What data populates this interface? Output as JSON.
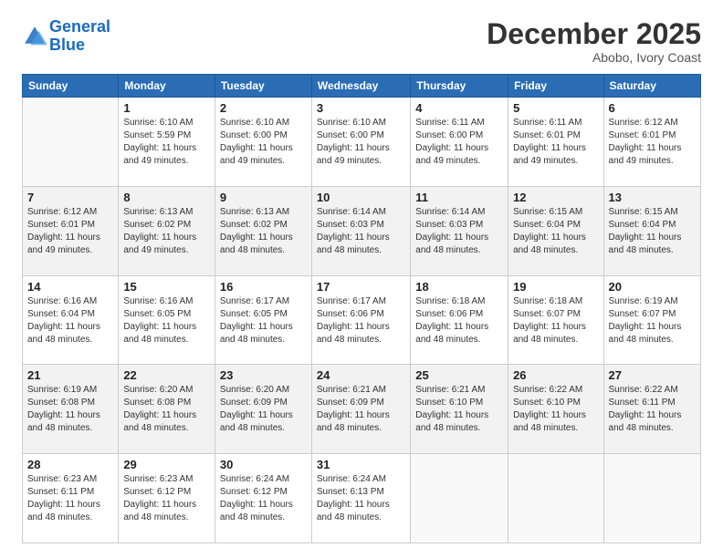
{
  "logo": {
    "line1": "General",
    "line2": "Blue"
  },
  "title": "December 2025",
  "subtitle": "Abobo, Ivory Coast",
  "weekdays": [
    "Sunday",
    "Monday",
    "Tuesday",
    "Wednesday",
    "Thursday",
    "Friday",
    "Saturday"
  ],
  "weeks": [
    [
      {
        "day": "",
        "info": ""
      },
      {
        "day": "1",
        "info": "Sunrise: 6:10 AM\nSunset: 5:59 PM\nDaylight: 11 hours\nand 49 minutes."
      },
      {
        "day": "2",
        "info": "Sunrise: 6:10 AM\nSunset: 6:00 PM\nDaylight: 11 hours\nand 49 minutes."
      },
      {
        "day": "3",
        "info": "Sunrise: 6:10 AM\nSunset: 6:00 PM\nDaylight: 11 hours\nand 49 minutes."
      },
      {
        "day": "4",
        "info": "Sunrise: 6:11 AM\nSunset: 6:00 PM\nDaylight: 11 hours\nand 49 minutes."
      },
      {
        "day": "5",
        "info": "Sunrise: 6:11 AM\nSunset: 6:01 PM\nDaylight: 11 hours\nand 49 minutes."
      },
      {
        "day": "6",
        "info": "Sunrise: 6:12 AM\nSunset: 6:01 PM\nDaylight: 11 hours\nand 49 minutes."
      }
    ],
    [
      {
        "day": "7",
        "info": "Sunrise: 6:12 AM\nSunset: 6:01 PM\nDaylight: 11 hours\nand 49 minutes."
      },
      {
        "day": "8",
        "info": "Sunrise: 6:13 AM\nSunset: 6:02 PM\nDaylight: 11 hours\nand 49 minutes."
      },
      {
        "day": "9",
        "info": "Sunrise: 6:13 AM\nSunset: 6:02 PM\nDaylight: 11 hours\nand 48 minutes."
      },
      {
        "day": "10",
        "info": "Sunrise: 6:14 AM\nSunset: 6:03 PM\nDaylight: 11 hours\nand 48 minutes."
      },
      {
        "day": "11",
        "info": "Sunrise: 6:14 AM\nSunset: 6:03 PM\nDaylight: 11 hours\nand 48 minutes."
      },
      {
        "day": "12",
        "info": "Sunrise: 6:15 AM\nSunset: 6:04 PM\nDaylight: 11 hours\nand 48 minutes."
      },
      {
        "day": "13",
        "info": "Sunrise: 6:15 AM\nSunset: 6:04 PM\nDaylight: 11 hours\nand 48 minutes."
      }
    ],
    [
      {
        "day": "14",
        "info": "Sunrise: 6:16 AM\nSunset: 6:04 PM\nDaylight: 11 hours\nand 48 minutes."
      },
      {
        "day": "15",
        "info": "Sunrise: 6:16 AM\nSunset: 6:05 PM\nDaylight: 11 hours\nand 48 minutes."
      },
      {
        "day": "16",
        "info": "Sunrise: 6:17 AM\nSunset: 6:05 PM\nDaylight: 11 hours\nand 48 minutes."
      },
      {
        "day": "17",
        "info": "Sunrise: 6:17 AM\nSunset: 6:06 PM\nDaylight: 11 hours\nand 48 minutes."
      },
      {
        "day": "18",
        "info": "Sunrise: 6:18 AM\nSunset: 6:06 PM\nDaylight: 11 hours\nand 48 minutes."
      },
      {
        "day": "19",
        "info": "Sunrise: 6:18 AM\nSunset: 6:07 PM\nDaylight: 11 hours\nand 48 minutes."
      },
      {
        "day": "20",
        "info": "Sunrise: 6:19 AM\nSunset: 6:07 PM\nDaylight: 11 hours\nand 48 minutes."
      }
    ],
    [
      {
        "day": "21",
        "info": "Sunrise: 6:19 AM\nSunset: 6:08 PM\nDaylight: 11 hours\nand 48 minutes."
      },
      {
        "day": "22",
        "info": "Sunrise: 6:20 AM\nSunset: 6:08 PM\nDaylight: 11 hours\nand 48 minutes."
      },
      {
        "day": "23",
        "info": "Sunrise: 6:20 AM\nSunset: 6:09 PM\nDaylight: 11 hours\nand 48 minutes."
      },
      {
        "day": "24",
        "info": "Sunrise: 6:21 AM\nSunset: 6:09 PM\nDaylight: 11 hours\nand 48 minutes."
      },
      {
        "day": "25",
        "info": "Sunrise: 6:21 AM\nSunset: 6:10 PM\nDaylight: 11 hours\nand 48 minutes."
      },
      {
        "day": "26",
        "info": "Sunrise: 6:22 AM\nSunset: 6:10 PM\nDaylight: 11 hours\nand 48 minutes."
      },
      {
        "day": "27",
        "info": "Sunrise: 6:22 AM\nSunset: 6:11 PM\nDaylight: 11 hours\nand 48 minutes."
      }
    ],
    [
      {
        "day": "28",
        "info": "Sunrise: 6:23 AM\nSunset: 6:11 PM\nDaylight: 11 hours\nand 48 minutes."
      },
      {
        "day": "29",
        "info": "Sunrise: 6:23 AM\nSunset: 6:12 PM\nDaylight: 11 hours\nand 48 minutes."
      },
      {
        "day": "30",
        "info": "Sunrise: 6:24 AM\nSunset: 6:12 PM\nDaylight: 11 hours\nand 48 minutes."
      },
      {
        "day": "31",
        "info": "Sunrise: 6:24 AM\nSunset: 6:13 PM\nDaylight: 11 hours\nand 48 minutes."
      },
      {
        "day": "",
        "info": ""
      },
      {
        "day": "",
        "info": ""
      },
      {
        "day": "",
        "info": ""
      }
    ]
  ]
}
